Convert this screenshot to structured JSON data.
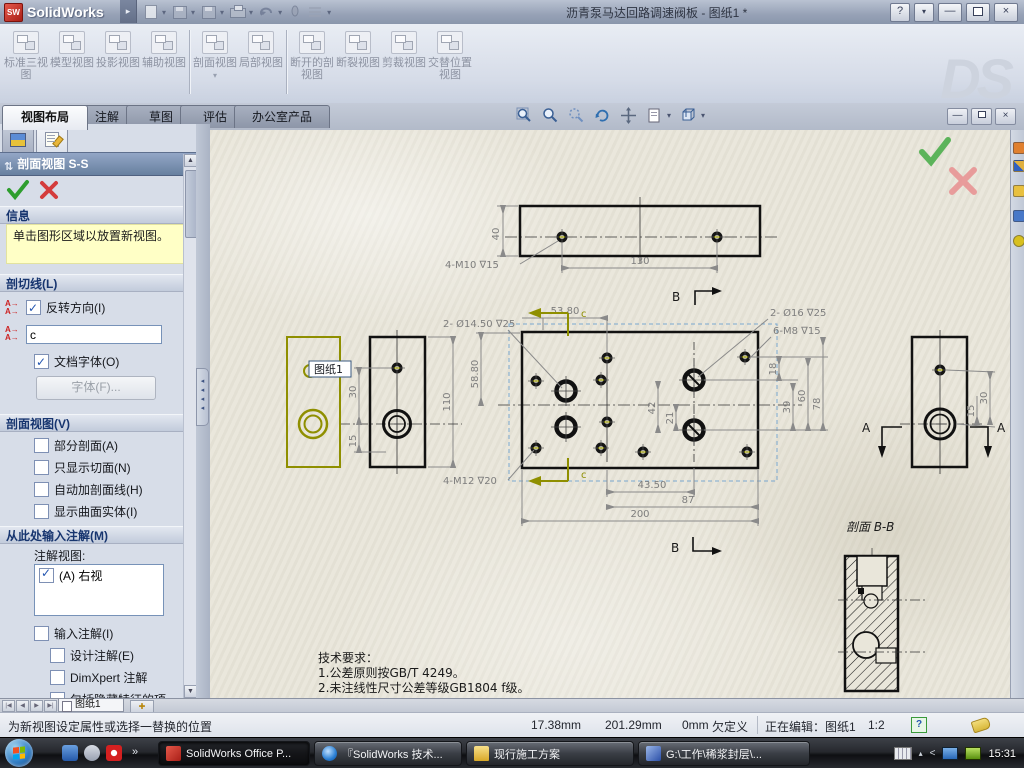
{
  "window": {
    "brand": "SolidWorks",
    "title": "沥青泵马达回路调速阀板 - 图纸1 *",
    "help": "?"
  },
  "ribbon": {
    "buttons": [
      "标准三视图",
      "模型视图",
      "投影视图",
      "辅助视图",
      "剖面视图",
      "局部视图",
      "断开的剖视图",
      "断裂视图",
      "剪裁视图",
      "交替位置视图"
    ],
    "watermark": "DS"
  },
  "tabs": [
    "视图布局",
    "注解",
    "草图",
    "评估",
    "办公室产品"
  ],
  "panel": {
    "title": "剖面视图 S-S",
    "help": "?",
    "info": {
      "title": "信息",
      "message": "单击图形区域以放置新视图。"
    },
    "cut_line": {
      "title": "剖切线(L)",
      "reverse": "反转方向(I)",
      "label_value": "c",
      "doc_font": "文档字体(O)",
      "font_button": "字体(F)..."
    },
    "section_view": {
      "title": "剖面视图(V)",
      "options": [
        "部分剖面(A)",
        "只显示切面(N)",
        "自动加剖面线(H)",
        "显示曲面实体(I)"
      ]
    },
    "annotations": {
      "title": "从此处输入注解(M)",
      "views_label": "注解视图:",
      "view_item": "(A) 右视",
      "import": "输入注解(I)",
      "design": "设计注解(E)",
      "dimxpert": "DimXpert 注解",
      "hidden": "包括隐藏特征的项"
    }
  },
  "drawing": {
    "tooltip": "图纸1",
    "labels": {
      "dim40": "40",
      "dim130": "130",
      "callout_m10": "4-M10 ∇15",
      "b_top": "B",
      "b_bottom": "B",
      "callout_d1450": "2- Ø14.50 ∇25",
      "dim5380": "53.80",
      "callout_d16": "2- Ø16 ∇25",
      "callout_m8": "6-M8 ∇15",
      "dim110": "110",
      "dim5880": "58.80",
      "dim42": "42",
      "dim21": "21",
      "dim18": "18",
      "dim39": "39",
      "dim60": "60",
      "dim78": "78",
      "callout_m12": "4-M12 ∇20",
      "dim4350": "43.50",
      "dim87": "87",
      "dim200": "200",
      "c_top": "c",
      "c_bottom": "c",
      "dim30_left": "30",
      "dim15_left": "15",
      "dim30_right": "30",
      "dim15_right": "15",
      "a_left": "A",
      "a_right": "A",
      "section_label": "剖面 B-B"
    },
    "notes": {
      "title": "技术要求：",
      "line1": "1.公差原则按GB/T 4249。",
      "line2": "2.未注线性尺寸公差等级GB1804 f级。"
    }
  },
  "sheet_bar": {
    "tab": "图纸1"
  },
  "status": {
    "message": "为新视图设定属性或选择一替换的位置",
    "x": "17.38mm",
    "y": "201.29mm",
    "z": "0mm",
    "state": "欠定义",
    "editing": "正在编辑：图纸1",
    "scale": "1:2"
  },
  "taskbar": {
    "buttons": [
      "SolidWorks Office P...",
      "『SolidWorks 技术...",
      "现行施工方案",
      "G:\\工作\\稀浆封层\\..."
    ],
    "time": "15:31"
  }
}
